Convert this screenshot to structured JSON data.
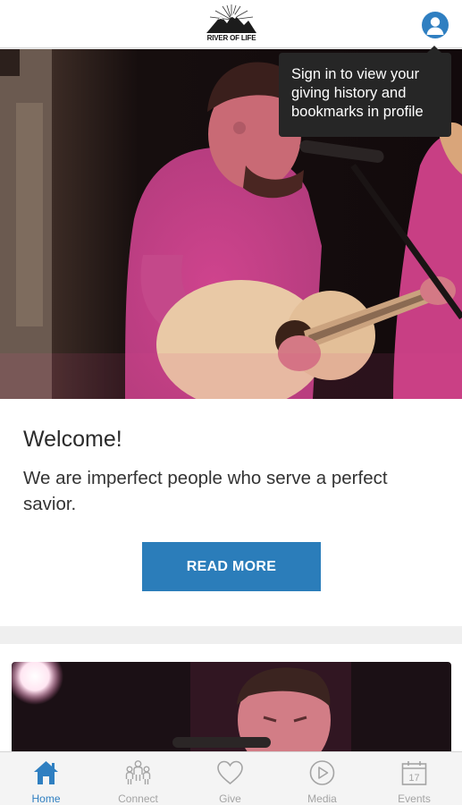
{
  "header": {
    "logo_text": "RIVER OF LIFE"
  },
  "tooltip": {
    "text": "Sign in to view your giving history and bookmarks in profile"
  },
  "feed": {
    "cards": [
      {
        "title": "Welcome!",
        "body": "We are imperfect people who serve a perfect savior.",
        "button_label": "READ MORE"
      }
    ]
  },
  "tabbar": {
    "tabs": [
      {
        "label": "Home",
        "icon": "home-icon",
        "active": true
      },
      {
        "label": "Connect",
        "icon": "people-icon",
        "active": false
      },
      {
        "label": "Give",
        "icon": "heart-icon",
        "active": false
      },
      {
        "label": "Media",
        "icon": "play-icon",
        "active": false
      },
      {
        "label": "Events",
        "icon": "calendar-icon",
        "active": false
      }
    ],
    "events_icon_day": "17"
  },
  "colors": {
    "accent": "#2b7dba",
    "tab_active": "#2f7fc1",
    "tab_inactive": "#a4a4a4",
    "tooltip_bg": "#262626"
  }
}
